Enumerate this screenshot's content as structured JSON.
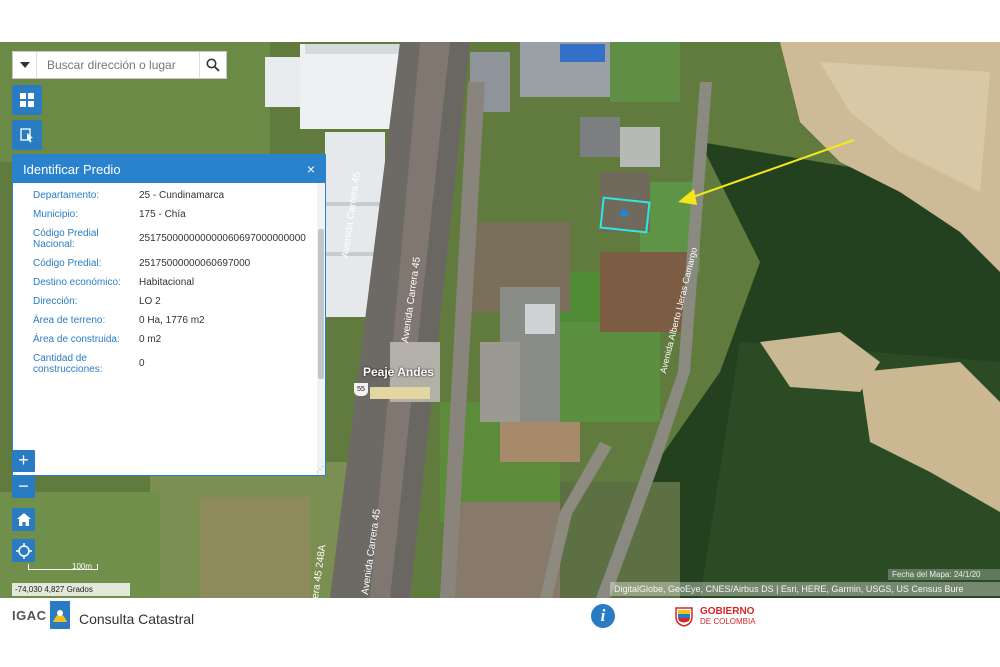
{
  "search": {
    "placeholder": "Buscar dirección o lugar"
  },
  "panel": {
    "title": "Identificar Predio",
    "close": "×",
    "rows": [
      {
        "label": "Departamento:",
        "value": "25 - Cundinamarca"
      },
      {
        "label": "Municipio:",
        "value": "175 - Chía"
      },
      {
        "label": "Código Predial Nacional:",
        "value": "251750000000000060697000000000"
      },
      {
        "label": "Código Predial:",
        "value": "25175000000060697000"
      },
      {
        "label": "Destino económico:",
        "value": "Habitacional"
      },
      {
        "label": "Dirección:",
        "value": "LO 2"
      },
      {
        "label": "Área de terreno:",
        "value": "0 Ha, 1776 m2"
      },
      {
        "label": "Área de construida:",
        "value": "0 m2"
      },
      {
        "label": "Cantidad de construcciones:",
        "value": "0"
      }
    ]
  },
  "zoom": {
    "in": "+",
    "out": "−"
  },
  "map": {
    "labels": {
      "peaje": "Peaje Andes",
      "road1": "Avenida Carrera 45",
      "road2": "Avenida Carrera 45",
      "road3": "Avenida Alberto Lleras Camargo",
      "road4": "Avenida Carrera 45",
      "road5": "era 45 248A",
      "shield": "55"
    },
    "scale": "100m",
    "coords": "-74,030 4,827 Grados",
    "date": "Fecha del Mapa: 24/1/20",
    "attribution": "DigitalGlobe, GeoEye, CNES/Airbus DS | Esri, HERE, Garmin, USGS, US Census Bure",
    "highlight_color": "#2ee8e0",
    "arrow_color": "#f5e61c"
  },
  "footer": {
    "logo": "IGAC",
    "app_name": "Consulta Catastral",
    "info": "i",
    "gov_line1": "GOBIERNO",
    "gov_line2": "DE COLOMBIA"
  },
  "colors": {
    "accent": "#2a7cc2",
    "gov_red": "#d3262a"
  }
}
